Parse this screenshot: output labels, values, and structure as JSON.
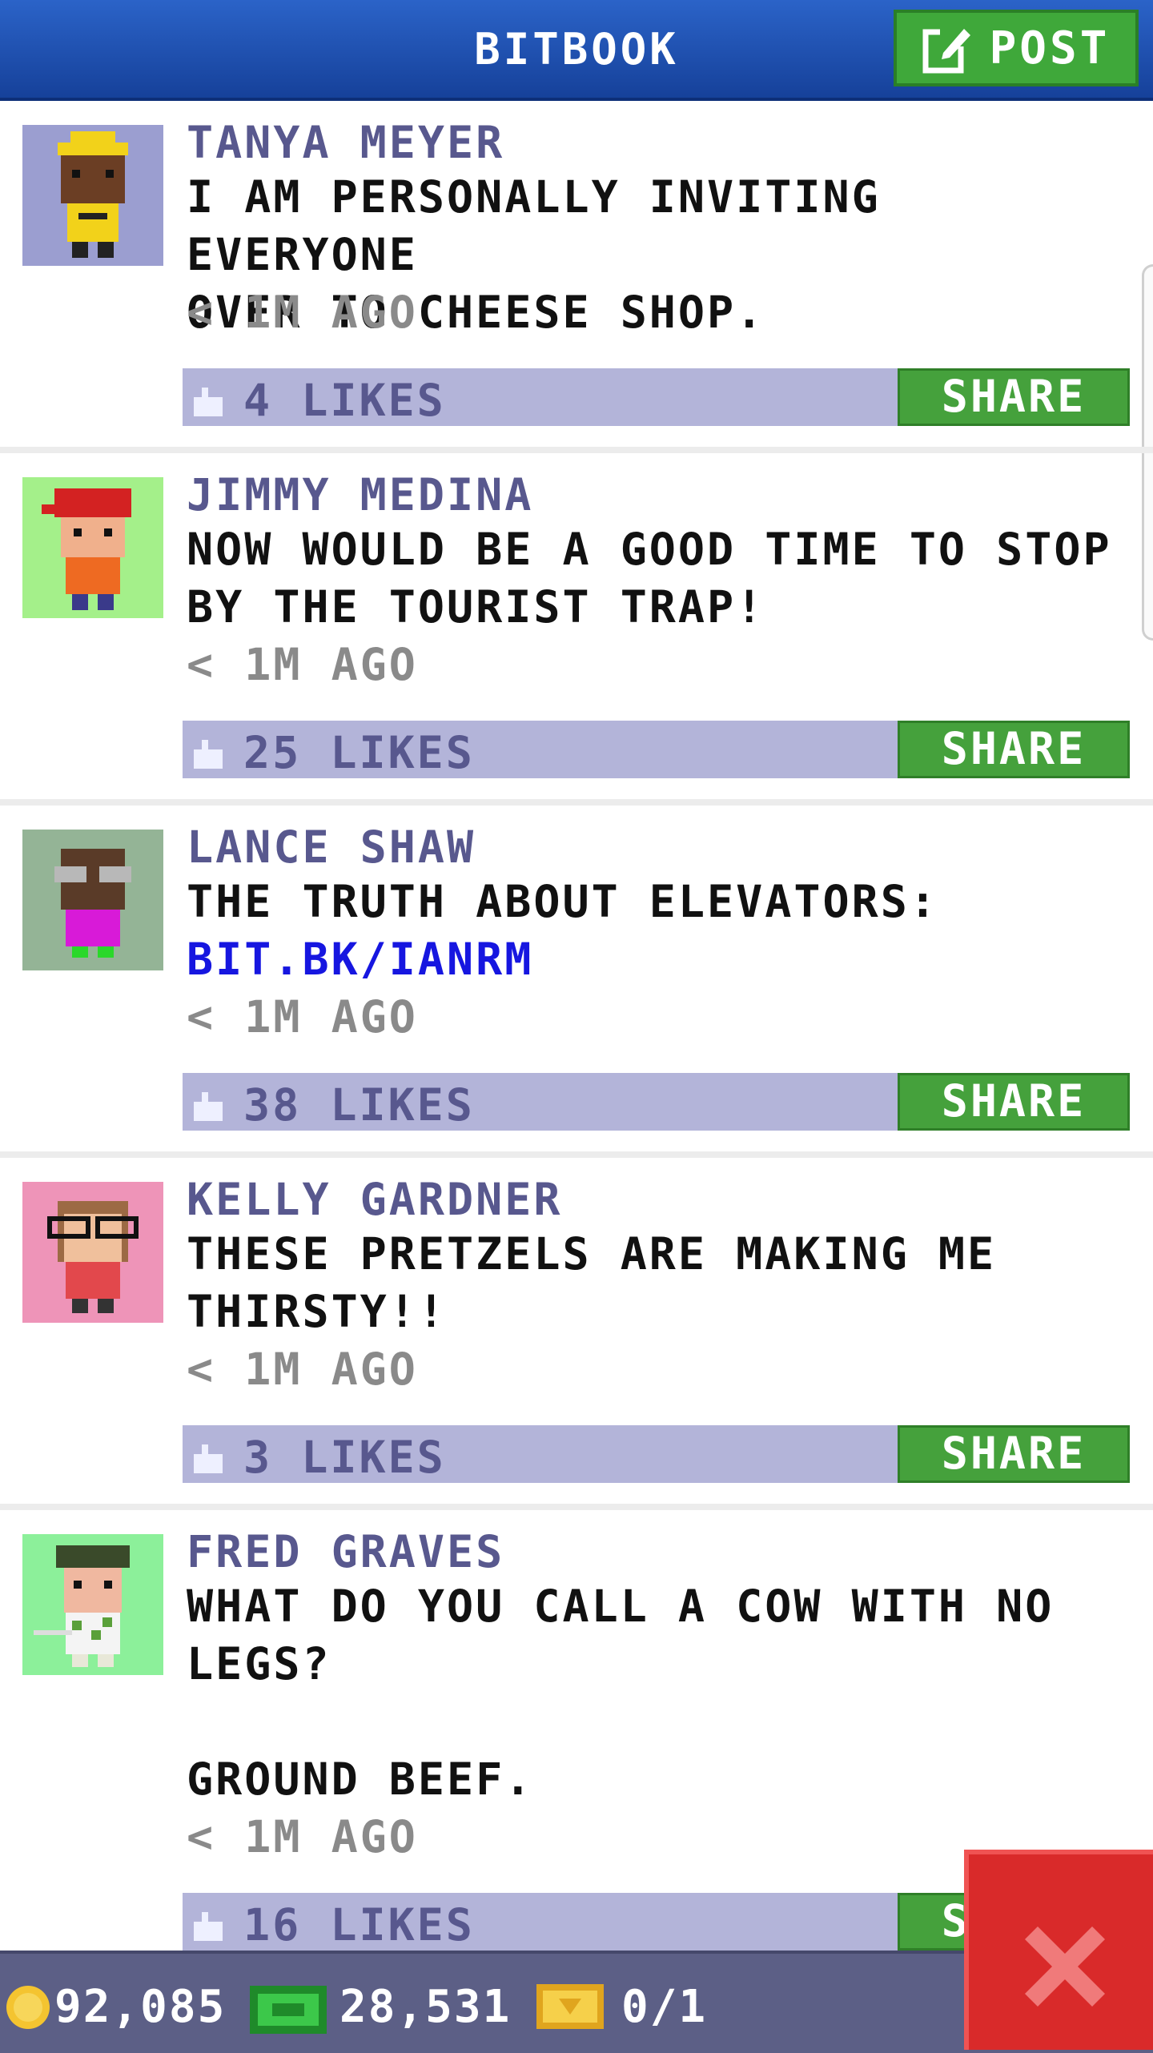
{
  "header": {
    "title": "BITBOOK",
    "post_label": "POST"
  },
  "posts": [
    {
      "name": "TANYA MEYER",
      "message": "I AM PERSONALLY INVITING EVERYONE\nOVER TO CHEESE SHOP.",
      "link": "",
      "time": "< 1M AGO",
      "likes": "4 LIKES",
      "share": "SHARE",
      "avatar_bg": "#9b9ed0"
    },
    {
      "name": "JIMMY MEDINA",
      "message": "NOW WOULD BE A GOOD TIME TO STOP\nBY THE TOURIST TRAP!",
      "link": "",
      "time": "< 1M AGO",
      "likes": "25 LIKES",
      "share": "SHARE",
      "avatar_bg": "#a4f08a"
    },
    {
      "name": "LANCE SHAW",
      "message": "THE TRUTH ABOUT ELEVATORS:",
      "link": "BIT.BK/IANRM",
      "time": "< 1M AGO",
      "likes": "38 LIKES",
      "share": "SHARE",
      "avatar_bg": "#94b496"
    },
    {
      "name": "KELLY GARDNER",
      "message": "THESE PRETZELS ARE MAKING ME\nTHIRSTY!!",
      "link": "",
      "time": "< 1M AGO",
      "likes": "3 LIKES",
      "share": "SHARE",
      "avatar_bg": "#ee94b8"
    },
    {
      "name": "FRED GRAVES",
      "message": "WHAT DO YOU CALL A COW WITH NO\nLEGS?\n\nGROUND BEEF.",
      "link": "",
      "time": "< 1M AGO",
      "likes": "16 LIKES",
      "share": "SHARE",
      "avatar_bg": "#8cf09a"
    }
  ],
  "footer": {
    "coins": "92,085",
    "bux": "28,531",
    "tickets": "0/1"
  },
  "colors": {
    "header": "#1f54b8",
    "post_green": "#3fa83a",
    "likes_bar": "#b3b4d9",
    "name": "#58588e",
    "footer": "#5c5f86",
    "close": "#d92a2a"
  }
}
